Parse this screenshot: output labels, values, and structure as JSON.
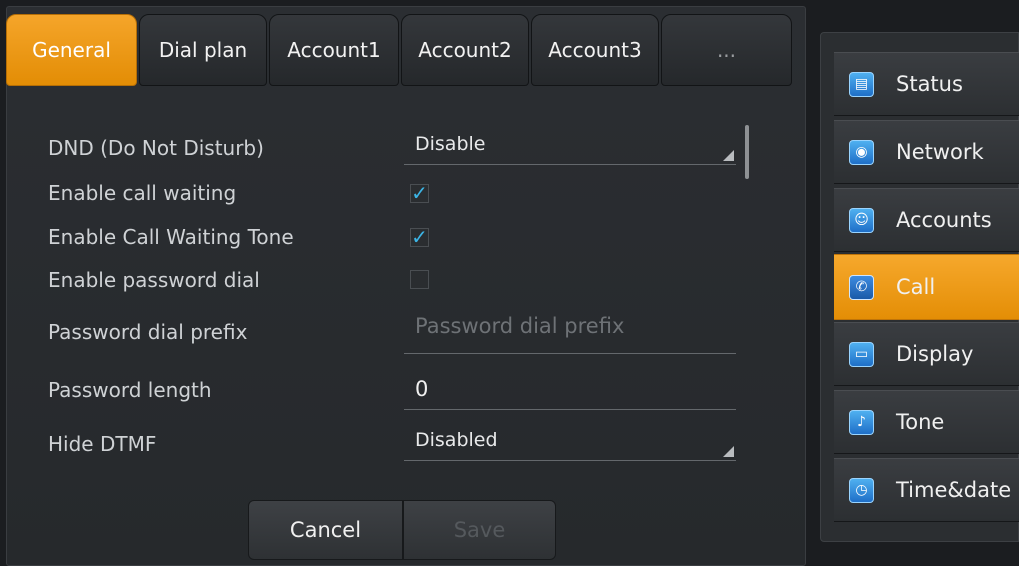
{
  "tabs": [
    {
      "label": "General",
      "active": true
    },
    {
      "label": "Dial plan",
      "active": false
    },
    {
      "label": "Account1",
      "active": false
    },
    {
      "label": "Account2",
      "active": false
    },
    {
      "label": "Account3",
      "active": false
    },
    {
      "label": "...",
      "active": false
    }
  ],
  "settings": {
    "dnd": {
      "label": "DND (Do Not Disturb)",
      "value": "Disable"
    },
    "call_waiting": {
      "label": "Enable call waiting",
      "checked": true
    },
    "call_waiting_tone": {
      "label": "Enable Call Waiting Tone",
      "checked": true
    },
    "password_dial": {
      "label": "Enable password dial",
      "checked": false
    },
    "password_prefix": {
      "label": "Password dial prefix",
      "value": "",
      "placeholder": "Password dial prefix"
    },
    "password_length": {
      "label": "Password length",
      "value": "0"
    },
    "hide_dtmf": {
      "label": "Hide DTMF",
      "value": "Disabled"
    }
  },
  "buttons": {
    "cancel": "Cancel",
    "save": "Save"
  },
  "sidebar": {
    "items": [
      {
        "label": "Status",
        "icon": "status-icon",
        "active": false
      },
      {
        "label": "Network",
        "icon": "network-icon",
        "active": false
      },
      {
        "label": "Accounts",
        "icon": "accounts-icon",
        "active": false
      },
      {
        "label": "Call",
        "icon": "call-icon",
        "active": true
      },
      {
        "label": "Display",
        "icon": "display-icon",
        "active": false
      },
      {
        "label": "Tone",
        "icon": "tone-icon",
        "active": false
      },
      {
        "label": "Time&date",
        "icon": "time-date-icon",
        "active": false
      }
    ]
  },
  "colors": {
    "accent": "#f0a020",
    "check": "#3cb5e6",
    "placeholder": "#6e7276",
    "save_disabled": "#55595d"
  }
}
